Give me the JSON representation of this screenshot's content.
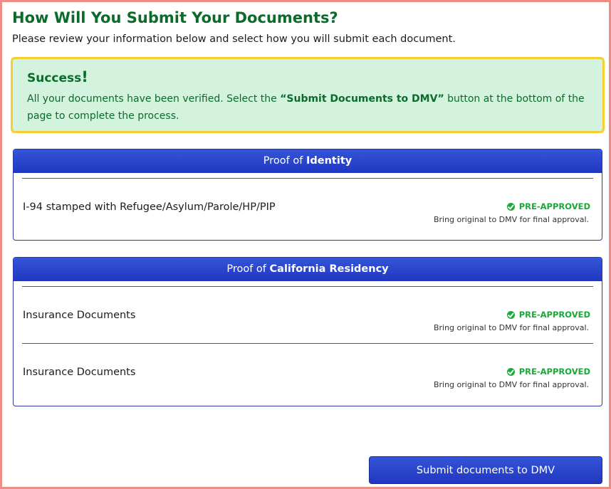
{
  "page": {
    "title": "How Will You Submit Your Documents?",
    "subtitle": "Please review your information below and select how you will submit each document."
  },
  "success": {
    "title": "Success",
    "title_mark": "!",
    "message_before": "All your documents have been verified. Select the ",
    "message_button_ref": "“Submit Documents to DMV”",
    "message_after": " button at the bottom of the page to complete the process."
  },
  "sections": [
    {
      "header_prefix": "Proof of ",
      "header_bold": "Identity",
      "documents": [
        {
          "name": "I-94 stamped with Refugee/Asylum/Parole/HP/PIP",
          "status": "PRE-APPROVED",
          "note": "Bring original to DMV for final approval."
        }
      ]
    },
    {
      "header_prefix": "Proof of ",
      "header_bold": "California Residency",
      "documents": [
        {
          "name": "Insurance Documents",
          "status": "PRE-APPROVED",
          "note": "Bring original to DMV for final approval."
        },
        {
          "name": "Insurance Documents",
          "status": "PRE-APPROVED",
          "note": "Bring original to DMV for final approval."
        }
      ]
    }
  ],
  "submit_label": "Submit documents to DMV",
  "colors": {
    "title_green": "#0b6b2a",
    "success_bg": "#d3f3df",
    "success_border": "#f3cf34",
    "header_blue": "#2a45cc",
    "status_green": "#1aa83a",
    "frame_border": "#f08b86"
  }
}
